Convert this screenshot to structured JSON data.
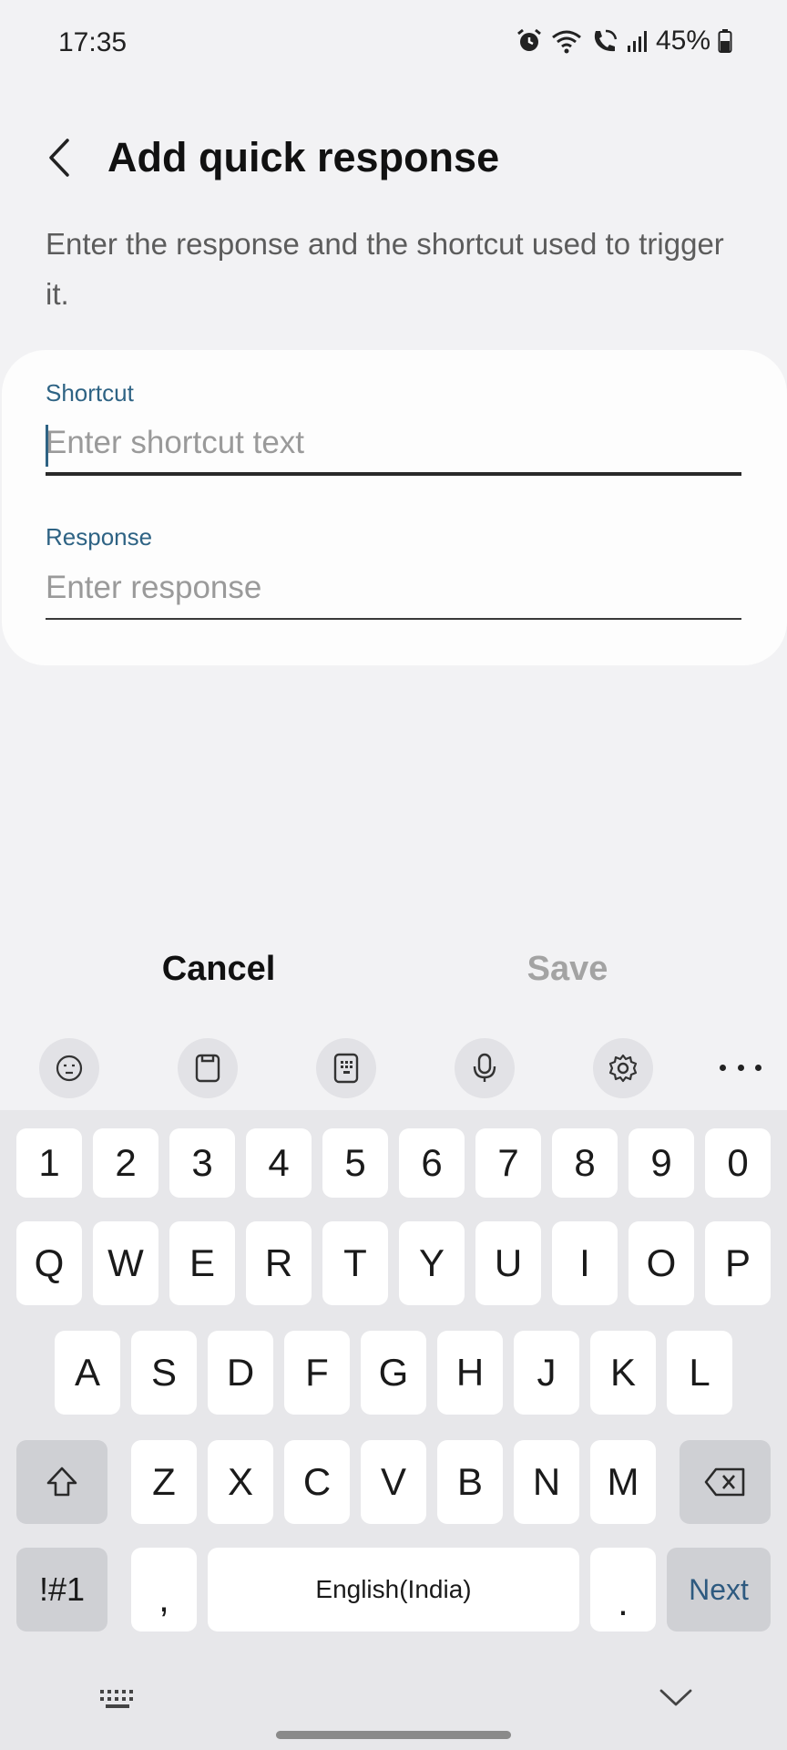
{
  "status": {
    "time": "17:35",
    "battery": "45%"
  },
  "header": {
    "title": "Add quick response"
  },
  "description": "Enter the response and the shortcut used to trigger it.",
  "form": {
    "shortcut_label": "Shortcut",
    "shortcut_placeholder": "Enter shortcut text",
    "response_label": "Response",
    "response_placeholder": "Enter response"
  },
  "actions": {
    "cancel": "Cancel",
    "save": "Save"
  },
  "keyboard": {
    "toolbar_icons": [
      "emoji-icon",
      "clipboard-icon",
      "keypad-icon",
      "microphone-icon",
      "gear-icon",
      "more-icon"
    ],
    "row_numbers": [
      "1",
      "2",
      "3",
      "4",
      "5",
      "6",
      "7",
      "8",
      "9",
      "0"
    ],
    "row_top": [
      "Q",
      "W",
      "E",
      "R",
      "T",
      "Y",
      "U",
      "I",
      "O",
      "P"
    ],
    "row_home": [
      "A",
      "S",
      "D",
      "F",
      "G",
      "H",
      "J",
      "K",
      "L"
    ],
    "row_bottom": [
      "Z",
      "X",
      "C",
      "V",
      "B",
      "N",
      "M"
    ],
    "symbols": "!#1",
    "comma": ",",
    "space": "English(India)",
    "period": ".",
    "next": "Next"
  }
}
